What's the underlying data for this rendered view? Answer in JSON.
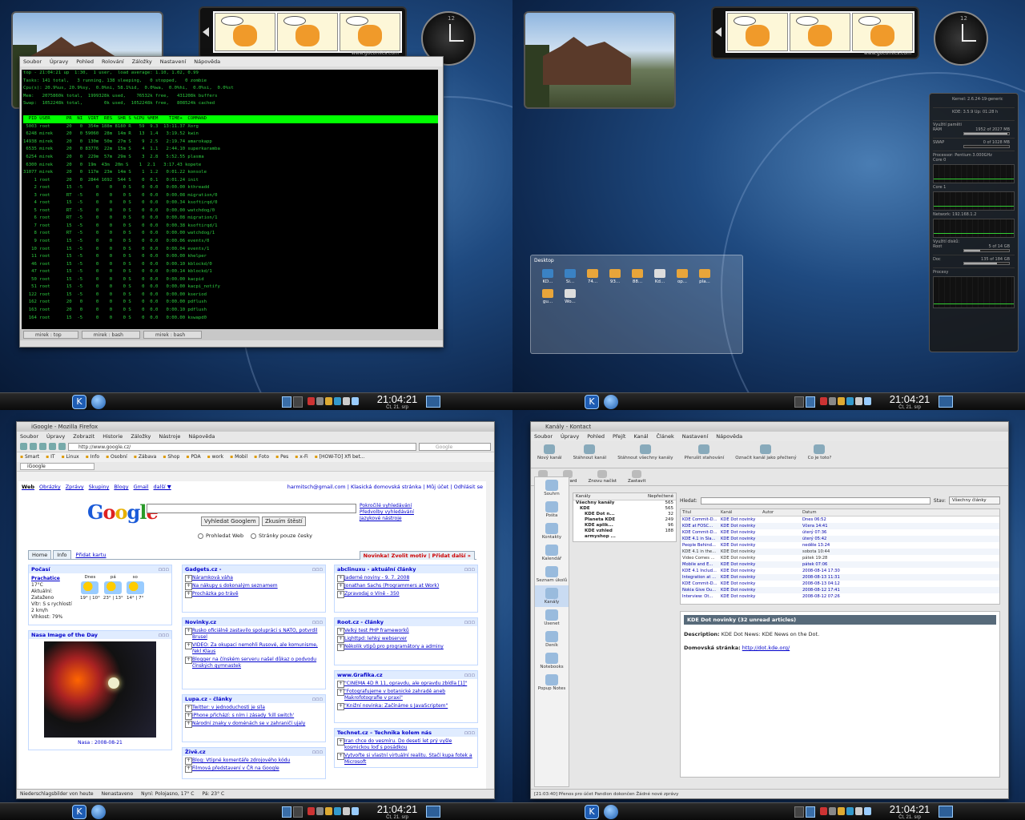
{
  "panel": {
    "time": "21:04:21",
    "date": "Čt, 21. srp"
  },
  "comic": {
    "url": "www.gocomics.com"
  },
  "terminal": {
    "menu": [
      "Soubor",
      "Úpravy",
      "Pohled",
      "Rolování",
      "Záložky",
      "Nastavení",
      "Nápověda"
    ],
    "lines": [
      "top - 21:04:21 up  1:30,  1 user,  load average: 1.10, 1.02, 0.99",
      "Tasks: 141 total,   3 running, 138 sleeping,   0 stopped,   0 zombie",
      "Cpu(s): 20.9%us, 20.9%sy,  0.0%ni, 58.1%id,  0.0%wa,  0.0%hi,  0.0%si,  0.0%st",
      "Mem:   2075860k total,  1999328k used,    76532k free,   431208k buffers",
      "Swap:  1052248k total,        0k used,  1052248k free,   808524k cached",
      "",
      "  PID USER      PR  NI  VIRT  RES  SHR S %CPU %MEM    TIME+  COMMAND",
      " 5003 root      20   0  354m 188m 8180 R   59  9.3  13:11.37 Xorg",
      " 6248 mirek     20   0 59060  28m  14m R   13  1.4   3:19.52 kwin",
      "14938 mirek     20   0  130m  50m  27m S    9  2.5   2:19.74 amarokapp",
      " 6535 mirek     20   0 83776  22m  15m S    4  1.1   2:44.10 superkaramba",
      " 6254 mirek     20   0  229m  57m  29m S    3  2.8   5:52.55 plasma",
      " 6300 mirek     20   0  19m  43m  20m S    1  2.1   3:17.43 kopete",
      "31077 mirek     20   0  117m  23m  14m S    1  1.2   0:01.22 konsole",
      "    1 root      20   0  2844 1692  544 S    0  0.1   0:01.24 init",
      "    2 root      15  -5     0    0    0 S    0  0.0   0:00.00 kthreadd",
      "    3 root      RT  -5     0    0    0 S    0  0.0   0:00.08 migration/0",
      "    4 root      15  -5     0    0    0 S    0  0.0   0:00.34 ksoftirqd/0",
      "    5 root      RT  -5     0    0    0 S    0  0.0   0:00.00 watchdog/0",
      "    6 root      RT  -5     0    0    0 S    0  0.0   0:00.08 migration/1",
      "    7 root      15  -5     0    0    0 S    0  0.0   0:00.38 ksoftirqd/1",
      "    8 root      RT  -5     0    0    0 S    0  0.0   0:00.00 watchdog/1",
      "    9 root      15  -5     0    0    0 S    0  0.0   0:00.06 events/0",
      "   10 root      15  -5     0    0    0 S    0  0.0   0:00.04 events/1",
      "   11 root      15  -5     0    0    0 S    0  0.0   0:00.00 khelper",
      "   46 root      15  -5     0    0    0 S    0  0.0   0:00.10 kblockd/0",
      "   47 root      15  -5     0    0    0 S    0  0.0   0:00.14 kblockd/1",
      "   50 root      15  -5     0    0    0 S    0  0.0   0:00.00 kacpid",
      "   51 root      15  -5     0    0    0 S    0  0.0   0:00.00 kacpi_notify",
      "  122 root      15  -5     0    0    0 S    0  0.0   0:00.00 kseriod",
      "  162 root      20   0     0    0    0 S    0  0.0   0:00.00 pdflush",
      "  163 root      20   0     0    0    0 S    0  0.0   0:00.10 pdflush",
      "  164 root      15  -5     0    0    0 S    0  0.0   0:00.00 kswapd0"
    ],
    "tabs": [
      "mirek : top",
      "mirek : bash",
      "mirek : bash"
    ]
  },
  "sysmon": {
    "kernel": "2.6.24-19-generic",
    "kde": "3.5.9",
    "uptime": "01:28 h",
    "memory_title": "Využití paměti",
    "ram": "1952 of 2027 MB",
    "swap": "0 of 1028 MB",
    "processor_title": "Processor:",
    "cpu": "Pentium 3.000GHz",
    "core1": "Core 0",
    "core2": "Core 1",
    "network_title": "Network:",
    "ip": "192.168.1.2",
    "disk_title": "Využití disků:",
    "root_disk": "5 of 14 GB",
    "docs_disk": "135 of 184 GB",
    "procs_title": "Procesy"
  },
  "desktop_folder": {
    "title": "Desktop",
    "icons": [
      "KD...",
      "Si...",
      "74...",
      "93...",
      "88...",
      "Kd...",
      "op...",
      "pla...",
      "gu...",
      "Wo..."
    ]
  },
  "firefox": {
    "title": "iGoogle - Mozilla Firefox",
    "menu": [
      "Soubor",
      "Úpravy",
      "Zobrazit",
      "Historie",
      "Záložky",
      "Nástroje",
      "Nápověda"
    ],
    "url": "http://www.google.cz/",
    "search_placeholder": "Google",
    "bookmarks": [
      "Smart",
      "IT",
      "Linux",
      "Info",
      "Osobní",
      "Zábava",
      "Shop",
      "PDA",
      "work",
      "Mobil",
      "Foto",
      "Pes",
      "x-Fi",
      "[HOW-TO] Xfi bet..."
    ],
    "tab": "iGoogle",
    "top_links": [
      "Web",
      "Obrázky",
      "Zprávy",
      "Skupiny",
      "Blogy",
      "Gmail",
      "další ▼"
    ],
    "account": "harmitsch@gmail.com | Klasická domovská stránka | Můj účet | Odhlásit se",
    "logo": "Google",
    "btn_search": "Vyhledat Googlem",
    "btn_lucky": "Zkusím štěstí",
    "side_links": [
      "Pokročilé vyhledávání",
      "Předvolby vyhledávání",
      "Jazykové nástroje"
    ],
    "radio_web": "Prohledat Web",
    "radio_cz": "Stránky pouze česky",
    "tabs": [
      "Home",
      "Info",
      "Přidat kartu"
    ],
    "novinka": "Novinka! Zvolit motiv | Přidat další »",
    "weather": {
      "title": "Počasí",
      "city": "Prachatice",
      "temp": "17°C",
      "cond": "Aktuální: Zataženo",
      "wind": "Vítr: S s rychlostí 2 km/h",
      "hum": "Vlhkost: 79%",
      "days": [
        {
          "d": "Dnes",
          "t": "19° | 10°"
        },
        {
          "d": "pá",
          "t": "23° | 13°"
        },
        {
          "d": "so",
          "t": "14° | 7°"
        }
      ]
    },
    "nasa": {
      "title": "Nasa Image of the Day",
      "caption": "Nasa : 2008-08-21"
    },
    "gadgets_col2": [
      {
        "title": "Gadgets.cz -",
        "items": [
          "Náramková váha",
          "Na nákupy s dokonalým seznamem",
          "Procházka po trávě"
        ]
      },
      {
        "title": "Novinky.cz",
        "items": [
          "Rusko oficiálně zastavilo spolupráci s NATO, potvrdil Brusel",
          "VIDEO: Za okupaci nemohli Rusové, ale komunisme, řekl Klaus",
          "Blogger na čínském serveru našel důkaz o podvodu čínských gymnastek"
        ]
      },
      {
        "title": "Lupa.cz - články",
        "items": [
          "Twitter: v jednoduchosti je síla",
          "iPhone přichází: s ním i zásady 'kill switch'",
          "Národní znaky v doménách se v zahraničí ujaly"
        ]
      },
      {
        "title": "Živě.cz",
        "items": [
          "Blog: Vtipné komentáře zdrojového kódu",
          "Filmová představení v ČR na Google"
        ]
      }
    ],
    "gadgets_col3": [
      {
        "title": "abclinuxu - aktuální články",
        "items": [
          "Jaderné noviny - 9. 7. 2008",
          "Jonathan Sachs (Programmers at Work)",
          "Zpravodaj o Víně - 350"
        ]
      },
      {
        "title": "Root.cz - články",
        "items": [
          "Velký test PHP frameworků",
          "Lighttpd: lehký webserver",
          "Několik vtipů pro programátory a adminy"
        ]
      },
      {
        "title": "www.Grafika.cz",
        "items": [
          "\"CINEMA 4D R 11, opravdu, ale opravdu zbídla [1]\"",
          "\"Fotografujeme v botanické zahradě aneb Makrofotografie v praxi\"",
          "\"Knižní novinka: Začínáme s JavaScriptem\""
        ]
      },
      {
        "title": "Technet.cz – Technika kolem nás",
        "items": [
          "Iran chce do vesmíru. Do deseti let prý vyšle kosmickou loď s posádkou",
          "Vytvořte si vlastní virtuální realitu. Stačí kupa fotek a Microsoft"
        ]
      }
    ],
    "status": [
      "Niederschlagsbilder von heute",
      "Nenastaveno",
      "Nyní: Polojasno, 17° C",
      "Pá: 23° C"
    ]
  },
  "akregator": {
    "title": "Kanály - Kontact",
    "menu": [
      "Soubor",
      "Úpravy",
      "Pohled",
      "Přejít",
      "Kanál",
      "Článek",
      "Nastavení",
      "Nápověda"
    ],
    "toolbar": [
      "Nový kanál",
      "Stáhnout kanál",
      "Stáhnout všechny kanály",
      "Přerušit stahování",
      "Označit kanál jako přečtený",
      "Co je toto?"
    ],
    "toolbar2": [
      "Back",
      "Forward",
      "Znovu načíst",
      "Zastavit"
    ],
    "sidebar": [
      "Souhrn",
      "Pošta",
      "Kontakty",
      "Kalendář",
      "Seznam úkolů",
      "Kanály",
      "Usenet",
      "Deník",
      "Notebooks",
      "Popup Notes"
    ],
    "feeds_header": [
      "Kanály",
      "Nepřečtené"
    ],
    "feeds": [
      {
        "n": "Všechny kanály",
        "c": "565"
      },
      {
        "n": "KDE",
        "c": "565"
      },
      {
        "n": "KDE Dot n...",
        "c": "32"
      },
      {
        "n": "Planeta KDE",
        "c": "249"
      },
      {
        "n": "KDE aplik...",
        "c": "96"
      },
      {
        "n": "KDE vzhled",
        "c": "188"
      },
      {
        "n": "armyshop ...",
        "c": ""
      }
    ],
    "search_label": "Hledat:",
    "status_label": "Stav:",
    "status_value": "Všechny články",
    "cols": [
      "Titul",
      "Kanál",
      "Autor",
      "Datum"
    ],
    "articles": [
      {
        "t": "KDE Commit-D...",
        "k": "KDE Dot novinky",
        "d": "Dnes 06:52",
        "r": false
      },
      {
        "t": "KDE at FOSC...",
        "k": "KDE Dot novinky",
        "d": "Včera 14:41",
        "r": false
      },
      {
        "t": "KDE Commit-D...",
        "k": "KDE Dot novinky",
        "d": "úterý 07:36",
        "r": false
      },
      {
        "t": "KDE 4.1 in Sla...",
        "k": "KDE Dot novinky",
        "d": "úterý 05:42",
        "r": false
      },
      {
        "t": "People Behind...",
        "k": "KDE Dot novinky",
        "d": "neděle 13:24",
        "r": false
      },
      {
        "t": "KDE 4.1 in the...",
        "k": "KDE Dot novinky",
        "d": "sobota 10:44",
        "r": true
      },
      {
        "t": "Video Comes ...",
        "k": "KDE Dot novinky",
        "d": "pátek 19:28",
        "r": true
      },
      {
        "t": "Mobile and E...",
        "k": "KDE Dot novinky",
        "d": "pátek 07:06",
        "r": false
      },
      {
        "t": "KDE 4.1 Includ...",
        "k": "KDE Dot novinky",
        "d": "2008-08-14 17:30",
        "r": false
      },
      {
        "t": "Integration at ...",
        "k": "KDE Dot novinky",
        "d": "2008-08-13 11:31",
        "r": false
      },
      {
        "t": "KDE Commit-D...",
        "k": "KDE Dot novinky",
        "d": "2008-08-13 04:12",
        "r": false
      },
      {
        "t": "Nokia Give Ou...",
        "k": "KDE Dot novinky",
        "d": "2008-08-12 17:41",
        "r": false
      },
      {
        "t": "Interview: Ot...",
        "k": "KDE Dot novinky",
        "d": "2008-08-12 07:26",
        "r": false
      }
    ],
    "preview_header": "KDE Dot novinky (32 unread articles)",
    "desc_label": "Description:",
    "desc": "KDE Dot News: KDE News on the Dot.",
    "home_label": "Domovská stránka:",
    "home_url": "http://dot.kde.org/",
    "status_bar": "[21:03:40] Přenos pro účet Pandion dokončen  Žádné nové zprávy"
  }
}
